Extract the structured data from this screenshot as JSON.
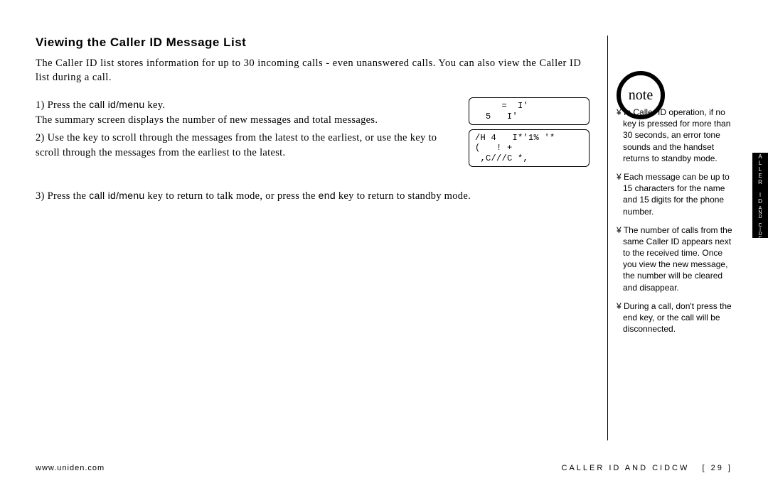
{
  "heading": "Viewing the Caller ID Message List",
  "intro": "The Caller ID list stores information for up to 30 incoming calls - even unanswered calls. You can also view the Caller ID list during a call.",
  "steps": {
    "s1_a": "1) Press the ",
    "s1_key": "call id/menu",
    "s1_b": " key.",
    "s1_c": "The summary screen displays the number of new messages and total messages.",
    "s2_a": "2) Use the     key to scroll through the messages from the latest to the earliest, or use the     key to scroll through the messages from the earliest to the latest.",
    "s3_a": "3) Press the ",
    "s3_key1": "call id/menu",
    "s3_b": " key to return to talk mode, or press the ",
    "s3_key2": "end",
    "s3_c": " key to return to standby mode."
  },
  "lcd1": "     =  I'\n  5   I'",
  "lcd2": "/H 4   I*'1% '*\n(   ! +\n ,C///C *,",
  "note_label": "note",
  "notes": {
    "n1": "In Caller ID operation, if no key is pressed for more than 30 seconds, an error tone sounds and the handset returns to standby mode.",
    "n2": "Each message can be up to 15 characters for the name and 15 digits for the phone number.",
    "n3": "The number of calls from the same Caller ID appears next to the received time. Once you view the new message, the number will be cleared and disappear.",
    "n4_a": "During a call, don't press the ",
    "n4_key": "end",
    "n4_b": " key, or the call will be disconnected."
  },
  "tab": {
    "line1": "CALLER ID",
    "line2": "AND CIDCW"
  },
  "footer": {
    "url": "www.uniden.com",
    "section": "CALLER ID AND CIDCW",
    "page": "[ 29 ]"
  }
}
